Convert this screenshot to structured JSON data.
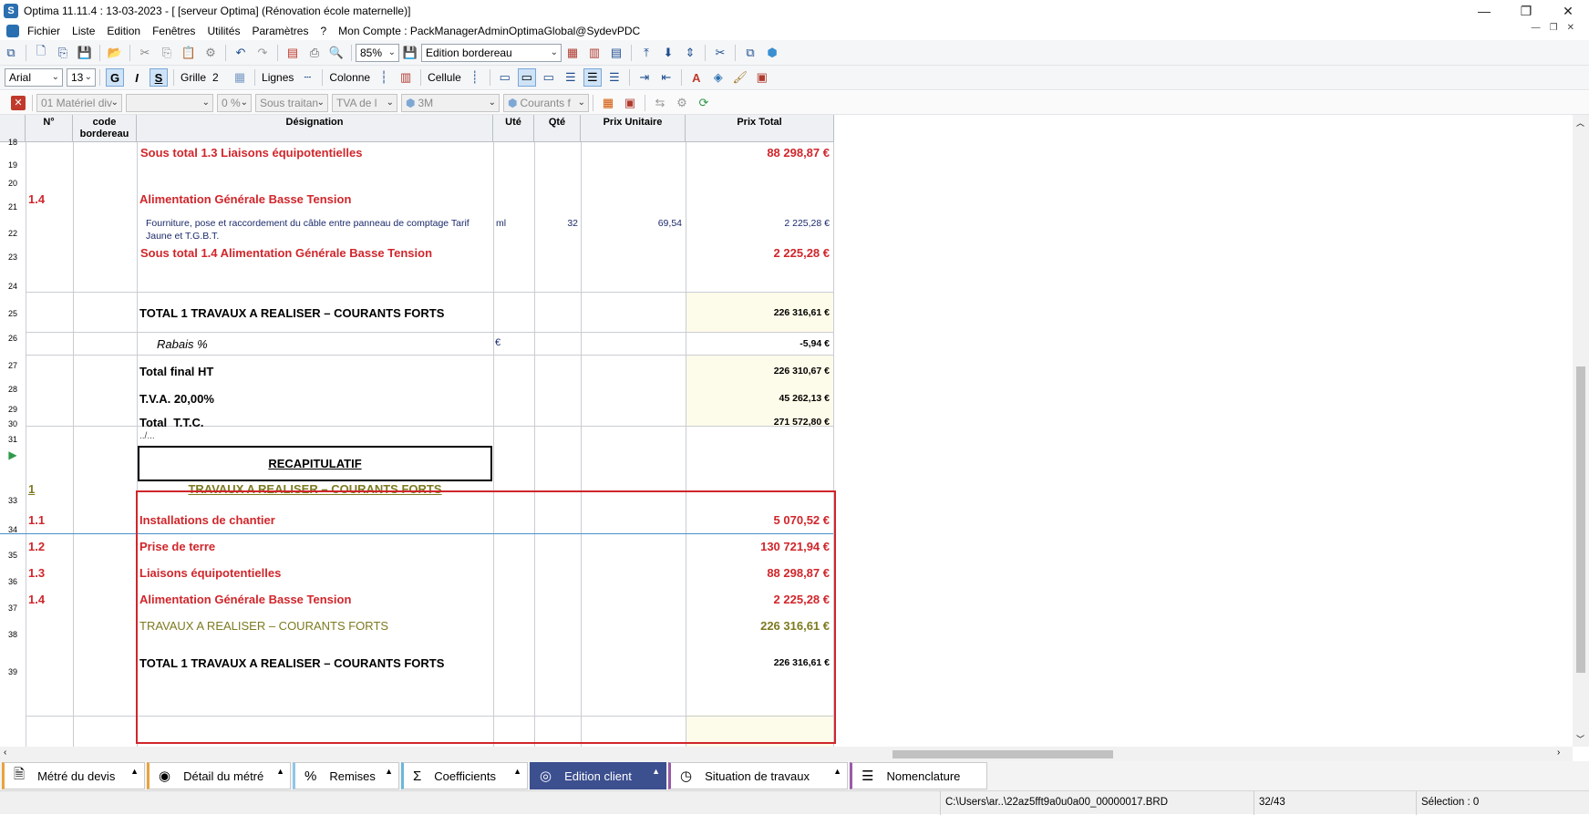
{
  "window": {
    "title": "Optima 11.11.4 : 13-03-2023 - [ [serveur Optima] (Rénovation école maternelle)]"
  },
  "menu": {
    "items": [
      "Fichier",
      "Liste",
      "Edition",
      "Fenêtres",
      "Utilités",
      "Paramètres",
      "?",
      "Mon Compte : PackManagerAdminOptimaGlobal@SydevPDC"
    ]
  },
  "toolbar": {
    "zoom": "85%",
    "view_select": "Edition bordereau",
    "font": "Arial",
    "font_size": "13",
    "bold": "G",
    "italic": "I",
    "strike": "S",
    "grid_label": "Grille",
    "grid_value": "2",
    "lines_label": "Lignes",
    "column_label": "Colonne",
    "cell_label": "Cellule"
  },
  "filterbar": {
    "lot": "01  Matériel div",
    "blank": "",
    "pct": "0 %",
    "subcontract": "Sous traitan",
    "tva": "TVA de l",
    "currency": "3M",
    "current": "Courants f"
  },
  "grid": {
    "headers": {
      "num": "N°",
      "code": "code bordereau",
      "designation": "Désignation",
      "unit": "Uté",
      "qty": "Qté",
      "unit_price": "Prix Unitaire",
      "total_price": "Prix Total"
    },
    "rows": [
      {
        "n": "18",
        "desig": "Sous total 1.3 Liaisons équipotentielles",
        "total": "88 298,87 €"
      },
      {
        "n": "19"
      },
      {
        "n": "20",
        "num": "1.4",
        "desig": "Alimentation Générale Basse Tension"
      },
      {
        "n": "21",
        "desig_line1": "Fourniture, pose et raccordement du câble entre panneau de comptage Tarif",
        "desig_line2": "Jaune et T.G.B.T.",
        "unit": "ml",
        "qty": "32",
        "unit_price": "69,54",
        "total": "2 225,28 €"
      },
      {
        "n": "22",
        "desig": "Sous total 1.4 Alimentation Générale Basse Tension",
        "total": "2 225,28 €"
      },
      {
        "n": "23"
      },
      {
        "n": "24",
        "desig": "TOTAL 1 TRAVAUX A REALISER – COURANTS FORTS",
        "total": "226 316,61 €"
      },
      {
        "n": "25",
        "desig": "Rabais %",
        "unit": "€",
        "total": "-5,94 €"
      },
      {
        "n": "26",
        "desig": "Total final HT",
        "total": "226 310,67 €"
      },
      {
        "n": "27",
        "desig": "T.V.A. 20,00%",
        "total": "45 262,13 €"
      },
      {
        "n": "28",
        "desig": "Total  T.T.C.",
        "total": "271 572,80 €"
      },
      {
        "n": "29"
      },
      {
        "n": "30"
      },
      {
        "n": "31",
        "desig": "../..."
      },
      {
        "n": "",
        "desig": "RECAPITULATIF"
      },
      {
        "n": "33",
        "num": "1",
        "desig": "TRAVAUX A REALISER – COURANTS FORTS"
      },
      {
        "n": "34",
        "num": "1.1",
        "desig": "Installations de chantier",
        "total": "5 070,52 €"
      },
      {
        "n": "35",
        "num": "1.2",
        "desig": "Prise de terre",
        "total": "130 721,94 €"
      },
      {
        "n": "36",
        "num": "1.3",
        "desig": "Liaisons équipotentielles",
        "total": "88 298,87 €"
      },
      {
        "n": "37",
        "num": "1.4",
        "desig": "Alimentation Générale Basse Tension",
        "total": "2 225,28 €"
      },
      {
        "n": "38",
        "desig": "TRAVAUX A REALISER – COURANTS FORTS",
        "total": "226 316,61 €"
      },
      {
        "n": "39",
        "desig": "TOTAL 1 TRAVAUX A REALISER – COURANTS FORTS",
        "total": "226 316,61 €"
      }
    ]
  },
  "tabs": [
    {
      "label": "Métré du devis",
      "icon": "document-icon"
    },
    {
      "label": "Détail du métré",
      "icon": "eye-icon"
    },
    {
      "label": "Remises",
      "icon": "percent-icon"
    },
    {
      "label": "Coefficients",
      "icon": "sigma-icon"
    },
    {
      "label": "Edition client",
      "icon": "user-icon"
    },
    {
      "label": "Situation de travaux",
      "icon": "clock-icon"
    },
    {
      "label": "Nomenclature",
      "icon": "list-icon"
    }
  ],
  "status": {
    "path": "C:\\Users\\ar..\\22az5fft9a0u0a00_00000017.BRD",
    "position": "32/43",
    "selection": "Sélection : 0"
  },
  "colors": {
    "red": "#d0262b",
    "olive": "#7d7a20",
    "active_tab": "#3c4f8f",
    "highlight_border": "#d0262b"
  }
}
